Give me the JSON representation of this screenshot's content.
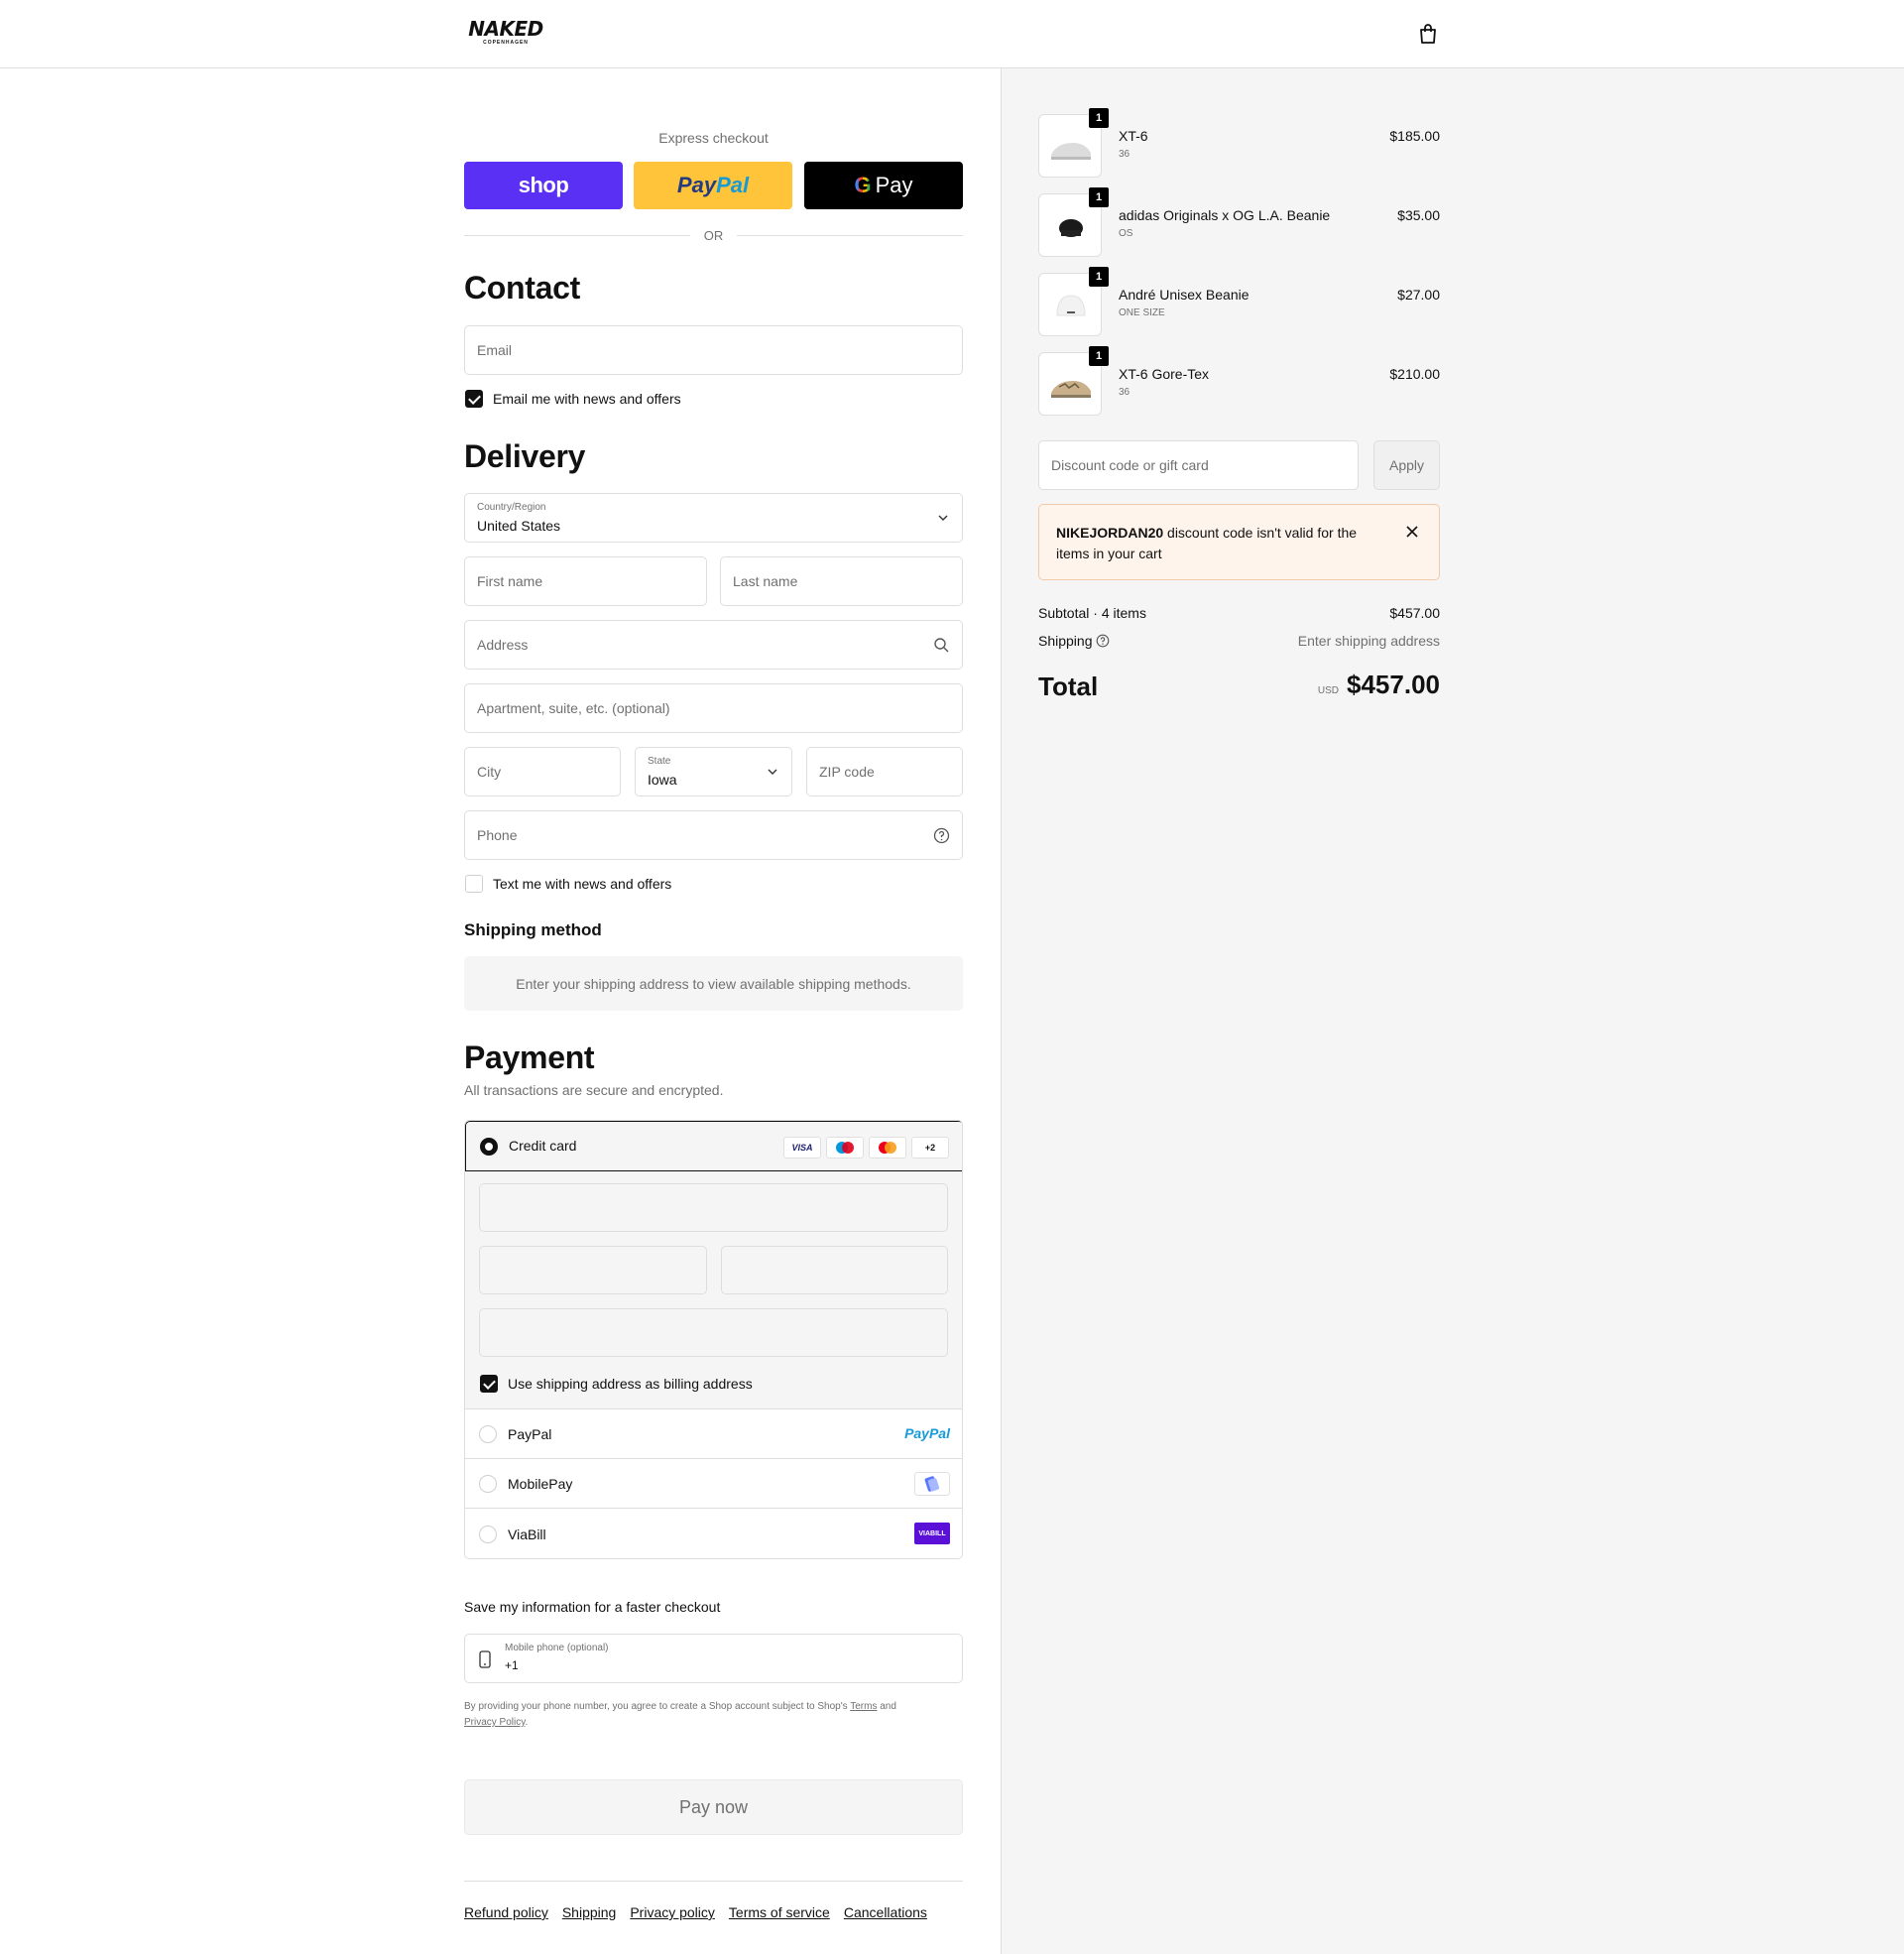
{
  "header": {
    "brand": "NAKED",
    "brand_sub": "COPENHAGEN",
    "cart_icon": "shopping-bag-icon"
  },
  "express": {
    "label": "Express checkout",
    "shop_label": "shop",
    "paypal_label_1": "Pay",
    "paypal_label_2": "Pal",
    "gpay_g": "G",
    "gpay_label": "Pay",
    "or": "OR",
    "colors": {
      "shop": "#5a31f4",
      "paypal": "#ffc439",
      "gpay": "#000000"
    }
  },
  "contact": {
    "title": "Contact",
    "email_placeholder": "Email",
    "news_label": "Email me with news and offers",
    "news_checked": true
  },
  "delivery": {
    "title": "Delivery",
    "country_label": "Country/Region",
    "country_value": "United States",
    "first_name": "First name",
    "last_name": "Last name",
    "address": "Address",
    "apartment": "Apartment, suite, etc. (optional)",
    "city": "City",
    "state_label": "State",
    "state_value": "Iowa",
    "zip": "ZIP code",
    "phone": "Phone",
    "text_label": "Text me with news and offers",
    "text_checked": false
  },
  "shipping": {
    "title": "Shipping method",
    "message": "Enter your shipping address to view available shipping methods."
  },
  "payment": {
    "title": "Payment",
    "subtitle": "All transactions are secure and encrypted.",
    "credit_card": "Credit card",
    "card_logos": [
      "VISA",
      "Maestro",
      "Mastercard",
      "+2"
    ],
    "billing_label": "Use shipping address as billing address",
    "billing_checked": true,
    "options": [
      {
        "label": "PayPal",
        "logo": "PayPal"
      },
      {
        "label": "MobilePay",
        "logo": "mobilepay-icon"
      },
      {
        "label": "ViaBill",
        "logo": "VIABILL"
      }
    ]
  },
  "save": {
    "title": "Save my information for a faster checkout",
    "mobile_label": "Mobile phone (optional)",
    "mobile_value": "+1",
    "legal_1": "By providing your phone number, you agree to create a Shop account subject to Shop's",
    "legal_terms": "Terms",
    "legal_and": "and",
    "legal_privacy": "Privacy Policy",
    "legal_end": "."
  },
  "pay_now": "Pay now",
  "footer": [
    "Refund policy",
    "Shipping",
    "Privacy policy",
    "Terms of service",
    "Cancellations"
  ],
  "cart": {
    "items": [
      {
        "qty": "1",
        "name": "XT-6",
        "variant": "36",
        "price": "$185.00"
      },
      {
        "qty": "1",
        "name": "adidas Originals x OG L.A. Beanie",
        "variant": "OS",
        "price": "$35.00"
      },
      {
        "qty": "1",
        "name": "André Unisex Beanie",
        "variant": "ONE SIZE",
        "price": "$27.00"
      },
      {
        "qty": "1",
        "name": "XT-6 Gore-Tex",
        "variant": "36",
        "price": "$210.00"
      }
    ],
    "discount_placeholder": "Discount code or gift card",
    "apply": "Apply",
    "error_code": "NIKEJORDAN20",
    "error_msg": " discount code isn't valid for the items in your cart",
    "subtotal_label": "Subtotal · 4 items",
    "subtotal_value": "$457.00",
    "shipping_label": "Shipping",
    "shipping_value": "Enter shipping address",
    "total_label": "Total",
    "total_currency": "USD",
    "total_value": "$457.00"
  }
}
